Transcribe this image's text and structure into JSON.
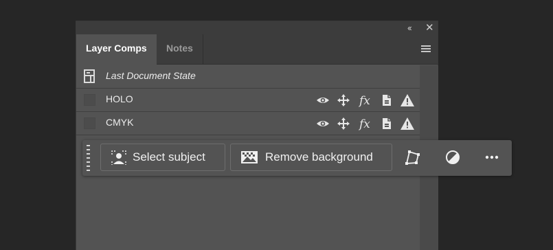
{
  "panel": {
    "collapse_glyph": "‹‹",
    "close_glyph": "✕",
    "tabs": [
      {
        "label": "Layer Comps",
        "active": true
      },
      {
        "label": "Notes",
        "active": false
      }
    ],
    "menu_icon": "panel-menu-icon"
  },
  "layer_comps": [
    {
      "label": "Last Document State",
      "italic": true,
      "icon": "document-state-icon"
    },
    {
      "label": "HOLO",
      "icons": [
        "visibility-eye-icon",
        "position-move-icon",
        "layer-style-fx-icon",
        "appearance-document-icon",
        "warning-icon"
      ]
    },
    {
      "label": "CMYK",
      "icons": [
        "visibility-eye-icon",
        "position-move-icon",
        "layer-style-fx-icon",
        "appearance-document-icon",
        "warning-icon"
      ]
    }
  ],
  "contextual_taskbar": {
    "select_subject_label": "Select subject",
    "remove_background_label": "Remove background",
    "icons": [
      "grip-icon",
      "select-subject-icon",
      "remove-background-icon",
      "transform-icon",
      "adjustment-icon",
      "more-options-icon"
    ]
  },
  "colors": {
    "background": "#262626",
    "panel": "#535353",
    "panel_header": "#3c3c3c",
    "text": "#ececec"
  }
}
